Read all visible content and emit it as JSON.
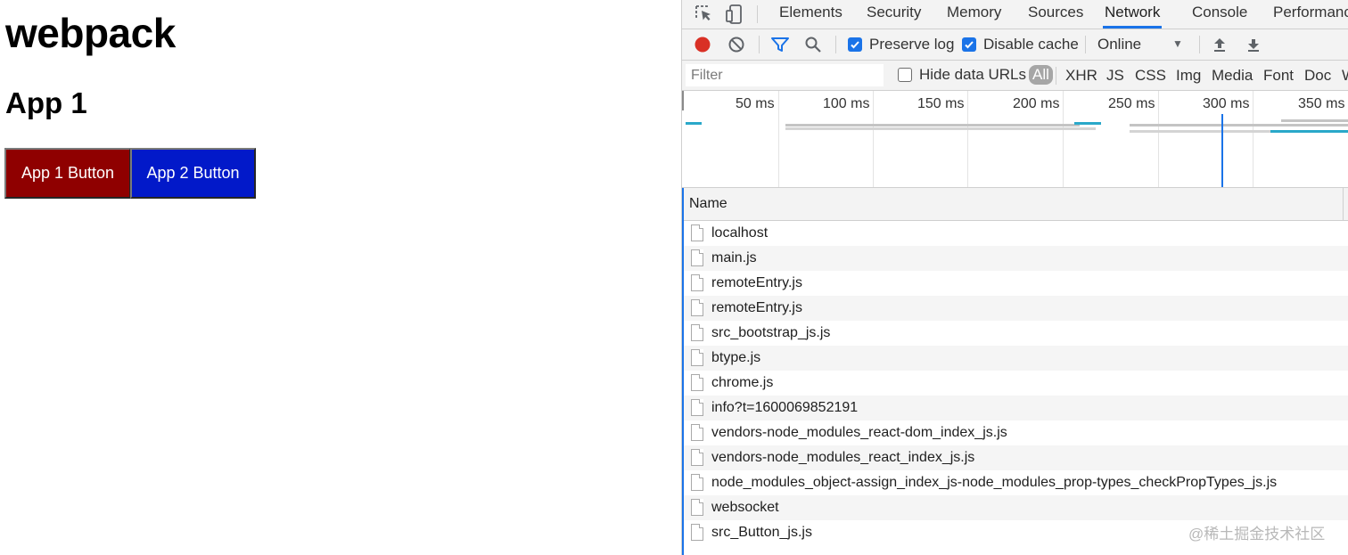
{
  "page": {
    "title": "webpack",
    "subtitle": "App 1",
    "buttons": [
      {
        "label": "App 1 Button",
        "color": "#8f0000"
      },
      {
        "label": "App 2 Button",
        "color": "#0219c9"
      }
    ]
  },
  "devtools": {
    "tabs": [
      "Elements",
      "Security",
      "Memory",
      "Sources",
      "Network",
      "Console",
      "Performance"
    ],
    "active_tab": "Network",
    "toolbar": {
      "preserve_log": {
        "label": "Preserve log",
        "checked": true
      },
      "disable_cache": {
        "label": "Disable cache",
        "checked": true
      },
      "throttle": "Online",
      "icons": [
        "inspect-icon",
        "device-toolbar-icon",
        "record-icon",
        "clear-icon",
        "filter-icon",
        "search-icon",
        "upload-icon",
        "download-icon"
      ]
    },
    "filter": {
      "placeholder": "Filter",
      "hide_data_urls": {
        "label": "Hide data URLs",
        "checked": false
      },
      "types": [
        "All",
        "XHR",
        "JS",
        "CSS",
        "Img",
        "Media",
        "Font",
        "Doc",
        "WS"
      ]
    },
    "timeline": {
      "ticks": [
        "50 ms",
        "100 ms",
        "150 ms",
        "200 ms",
        "250 ms",
        "300 ms",
        "350 ms"
      ]
    },
    "table": {
      "columns": [
        "Name"
      ],
      "rows": [
        "localhost",
        "main.js",
        "remoteEntry.js",
        "remoteEntry.js",
        "src_bootstrap_js.js",
        "btype.js",
        "chrome.js",
        "info?t=1600069852191",
        "vendors-node_modules_react-dom_index_js.js",
        "vendors-node_modules_react_index_js.js",
        "node_modules_object-assign_index_js-node_modules_prop-types_checkPropTypes_js.js",
        "websocket",
        "src_Button_js.js"
      ]
    },
    "watermark": "@稀土掘金技术社区"
  }
}
